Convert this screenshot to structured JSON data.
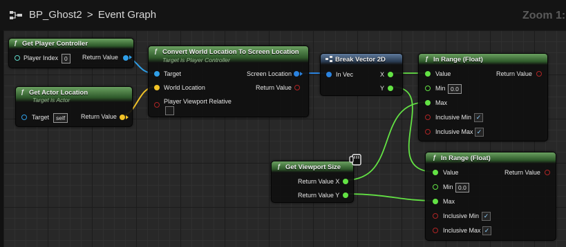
{
  "title": {
    "breadcrumb": "BP_Ghost2",
    "separator": ">",
    "graph_name": "Event Graph",
    "zoom": "Zoom 1:1"
  },
  "nodes": {
    "get_player_controller": {
      "title": "Get Player Controller",
      "player_index_label": "Player Index",
      "player_index_value": "0",
      "return_label": "Return Value"
    },
    "get_actor_location": {
      "title": "Get Actor Location",
      "subtitle": "Target is Actor",
      "target_label": "Target",
      "target_value": "self",
      "return_label": "Return Value"
    },
    "convert_world": {
      "title": "Convert World Location To Screen Location",
      "subtitle": "Target is Player Controller",
      "target_label": "Target",
      "world_location_label": "World Location",
      "viewport_relative_label": "Player Viewport Relative",
      "screen_location_label": "Screen Location",
      "return_label": "Return Value"
    },
    "break_vector": {
      "title": "Break Vector 2D",
      "in_vec_label": "In Vec",
      "x_label": "X",
      "y_label": "Y"
    },
    "in_range_1": {
      "title": "In Range (Float)",
      "value_label": "Value",
      "return_label": "Return Value",
      "min_label": "Min",
      "min_value": "0.0",
      "max_label": "Max",
      "inclusive_min_label": "Inclusive Min",
      "inclusive_max_label": "Inclusive Max",
      "check": "✓"
    },
    "in_range_2": {
      "title": "In Range (Float)",
      "value_label": "Value",
      "return_label": "Return Value",
      "min_label": "Min",
      "min_value": "0.0",
      "max_label": "Max",
      "inclusive_min_label": "Inclusive Min",
      "inclusive_max_label": "Inclusive Max",
      "check": "✓"
    },
    "get_viewport_size": {
      "title": "Get Viewport Size",
      "return_x_label": "Return Value X",
      "return_y_label": "Return Value Y"
    }
  },
  "colors": {
    "object_pin": "#2f9fe8",
    "vector_pin": "#f2c327",
    "float_pin": "#63e244",
    "bool_pin": "#9a1a1a",
    "vector2d_pin": "#2a83e0",
    "pure_header": "#4c7d44",
    "break_header": "#4a6280"
  },
  "icons": {
    "function": "ƒ",
    "title_icon": "blueprint-graph-icon",
    "break_icon": "break-struct-icon",
    "cursor": "hand-cursor-icon"
  }
}
